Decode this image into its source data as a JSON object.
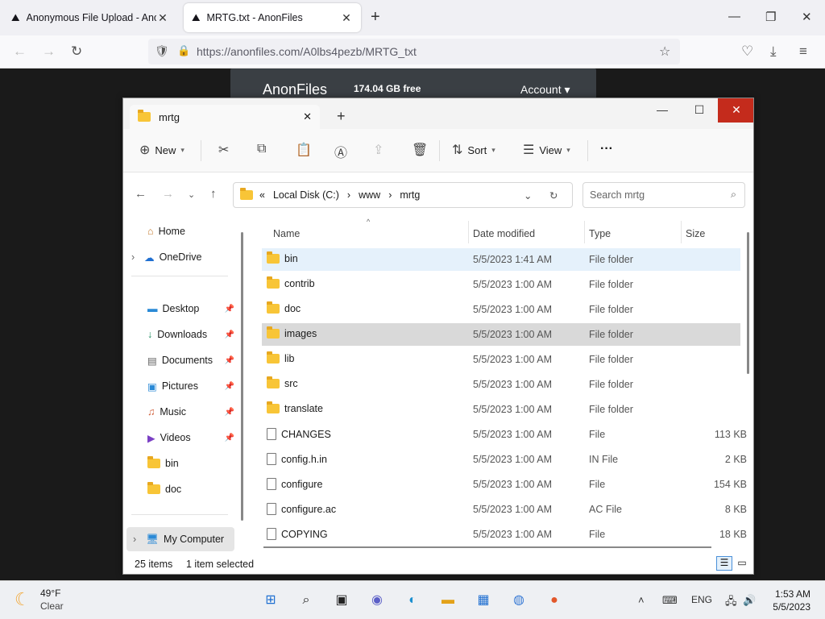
{
  "browser": {
    "tabs": [
      {
        "title": "Anonymous File Upload - Anon"
      },
      {
        "title": "MRTG.txt - AnonFiles"
      }
    ],
    "url": "https://anonfiles.com/A0lbs4pezb/MRTG_txt"
  },
  "site": {
    "brand": "AnonFiles",
    "free": "174.04 GB free",
    "account": "Account"
  },
  "explorer": {
    "tab_title": "mrtg",
    "toolbar": {
      "new": "New",
      "sort": "Sort",
      "view": "View",
      "more": "···"
    },
    "address": {
      "prefix": "«",
      "crumbs": [
        "Local Disk (C:)",
        "www",
        "mrtg"
      ]
    },
    "search_placeholder": "Search mrtg",
    "sidebar": {
      "home": "Home",
      "onedrive": "OneDrive",
      "quick": [
        "Desktop",
        "Downloads",
        "Documents",
        "Pictures",
        "Music",
        "Videos",
        "bin",
        "doc"
      ],
      "computer": "My Computer"
    },
    "columns": {
      "name": "Name",
      "date": "Date modified",
      "type": "Type",
      "size": "Size"
    },
    "files": [
      {
        "name": "bin",
        "date": "5/5/2023 1:41 AM",
        "type": "File folder",
        "size": ""
      },
      {
        "name": "contrib",
        "date": "5/5/2023 1:00 AM",
        "type": "File folder",
        "size": ""
      },
      {
        "name": "doc",
        "date": "5/5/2023 1:00 AM",
        "type": "File folder",
        "size": ""
      },
      {
        "name": "images",
        "date": "5/5/2023 1:00 AM",
        "type": "File folder",
        "size": ""
      },
      {
        "name": "lib",
        "date": "5/5/2023 1:00 AM",
        "type": "File folder",
        "size": ""
      },
      {
        "name": "src",
        "date": "5/5/2023 1:00 AM",
        "type": "File folder",
        "size": ""
      },
      {
        "name": "translate",
        "date": "5/5/2023 1:00 AM",
        "type": "File folder",
        "size": ""
      },
      {
        "name": "CHANGES",
        "date": "5/5/2023 1:00 AM",
        "type": "File",
        "size": "113 KB"
      },
      {
        "name": "config.h.in",
        "date": "5/5/2023 1:00 AM",
        "type": "IN File",
        "size": "2 KB"
      },
      {
        "name": "configure",
        "date": "5/5/2023 1:00 AM",
        "type": "File",
        "size": "154 KB"
      },
      {
        "name": "configure.ac",
        "date": "5/5/2023 1:00 AM",
        "type": "AC File",
        "size": "8 KB"
      },
      {
        "name": "COPYING",
        "date": "5/5/2023 1:00 AM",
        "type": "File",
        "size": "18 KB"
      }
    ],
    "status": {
      "count": "25 items",
      "selected": "1 item selected"
    }
  },
  "taskbar": {
    "weather_temp": "49°F",
    "weather_desc": "Clear",
    "lang": "ENG",
    "time": "1:53 AM",
    "date": "5/5/2023"
  }
}
